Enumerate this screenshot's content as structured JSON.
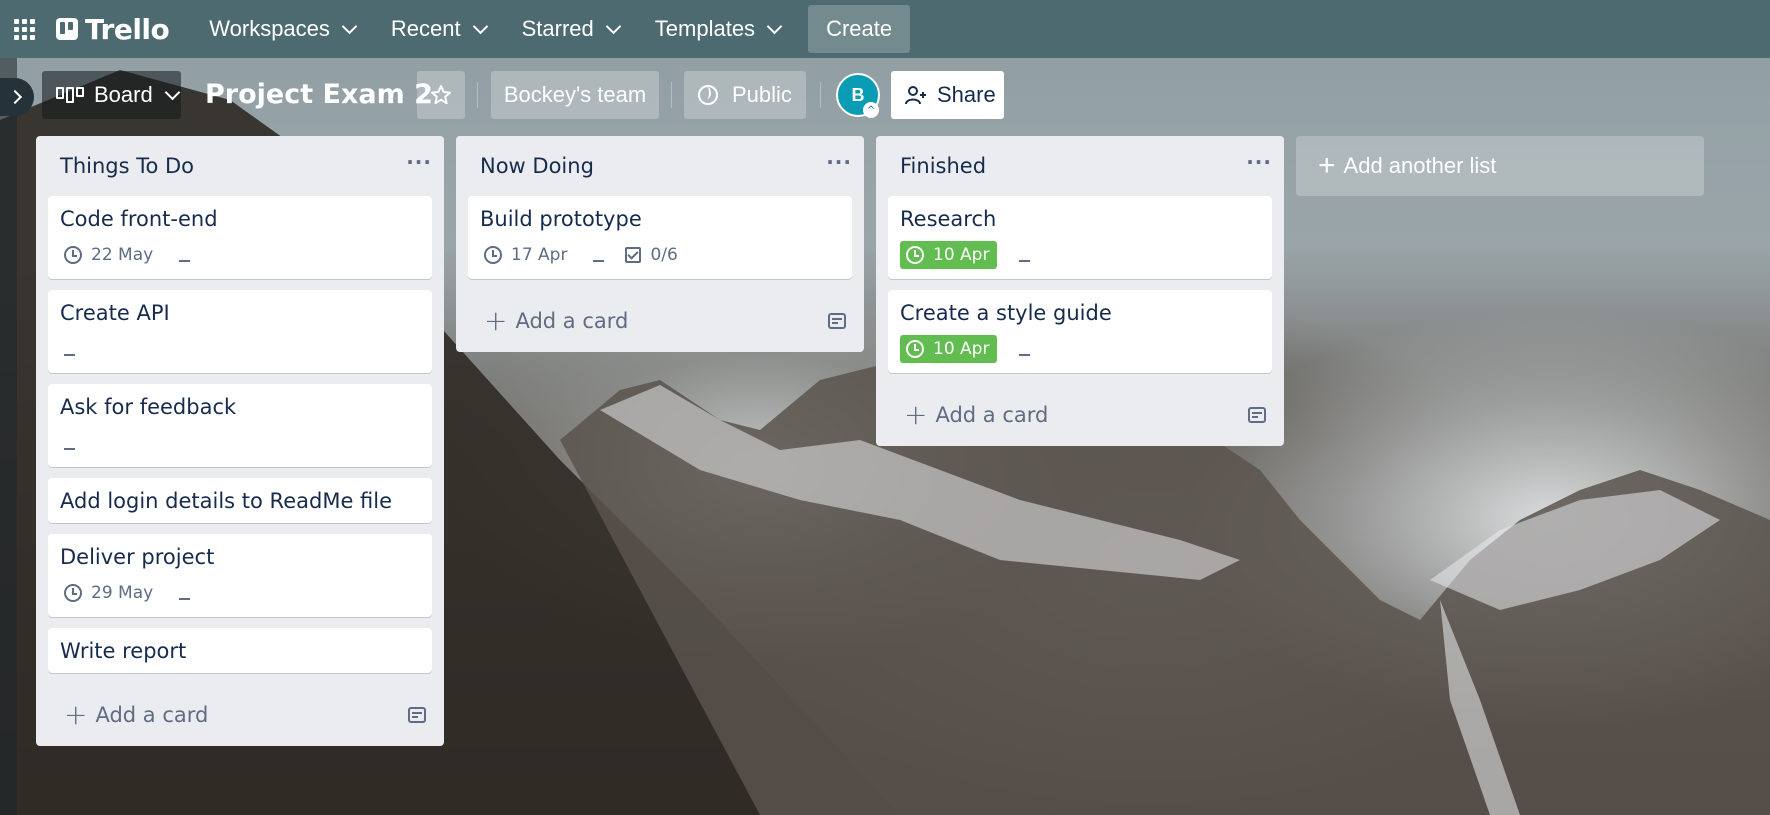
{
  "header": {
    "logo_text": "Trello",
    "nav": [
      {
        "label": "Workspaces"
      },
      {
        "label": "Recent"
      },
      {
        "label": "Starred"
      },
      {
        "label": "Templates"
      }
    ],
    "create_label": "Create"
  },
  "board": {
    "view_label": "Board",
    "title": "Project Exam 2",
    "team_label": "Bockey's team",
    "visibility_label": "Public",
    "avatar_initial": "B",
    "share_label": "Share"
  },
  "lists": [
    {
      "title": "Things To Do",
      "menu": "···",
      "add_card_label": "Add a card",
      "cards": [
        {
          "title": "Code front-end",
          "due": "22 May"
        },
        {
          "title": "Create API"
        },
        {
          "title": "Ask for feedback"
        },
        {
          "title": "Add login details to ReadMe file"
        },
        {
          "title": "Deliver project",
          "due": "29 May"
        },
        {
          "title": "Write report"
        }
      ]
    },
    {
      "title": "Now Doing",
      "menu": "···",
      "add_card_label": "Add a card",
      "cards": [
        {
          "title": "Build prototype",
          "due": "17 Apr",
          "checklist": "0/6"
        }
      ]
    },
    {
      "title": "Finished",
      "menu": "···",
      "add_card_label": "Add a card",
      "cards": [
        {
          "title": "Research",
          "due": "10 Apr"
        },
        {
          "title": "Create a style guide",
          "due": "10 Apr"
        }
      ]
    }
  ],
  "add_list_label": "Add another list",
  "colors": {
    "header_bg": "#4c6a6f",
    "list_bg": "#ebecf0",
    "due_complete": "#61bd4f",
    "text": "#172b4d",
    "muted": "#5e6c84"
  }
}
